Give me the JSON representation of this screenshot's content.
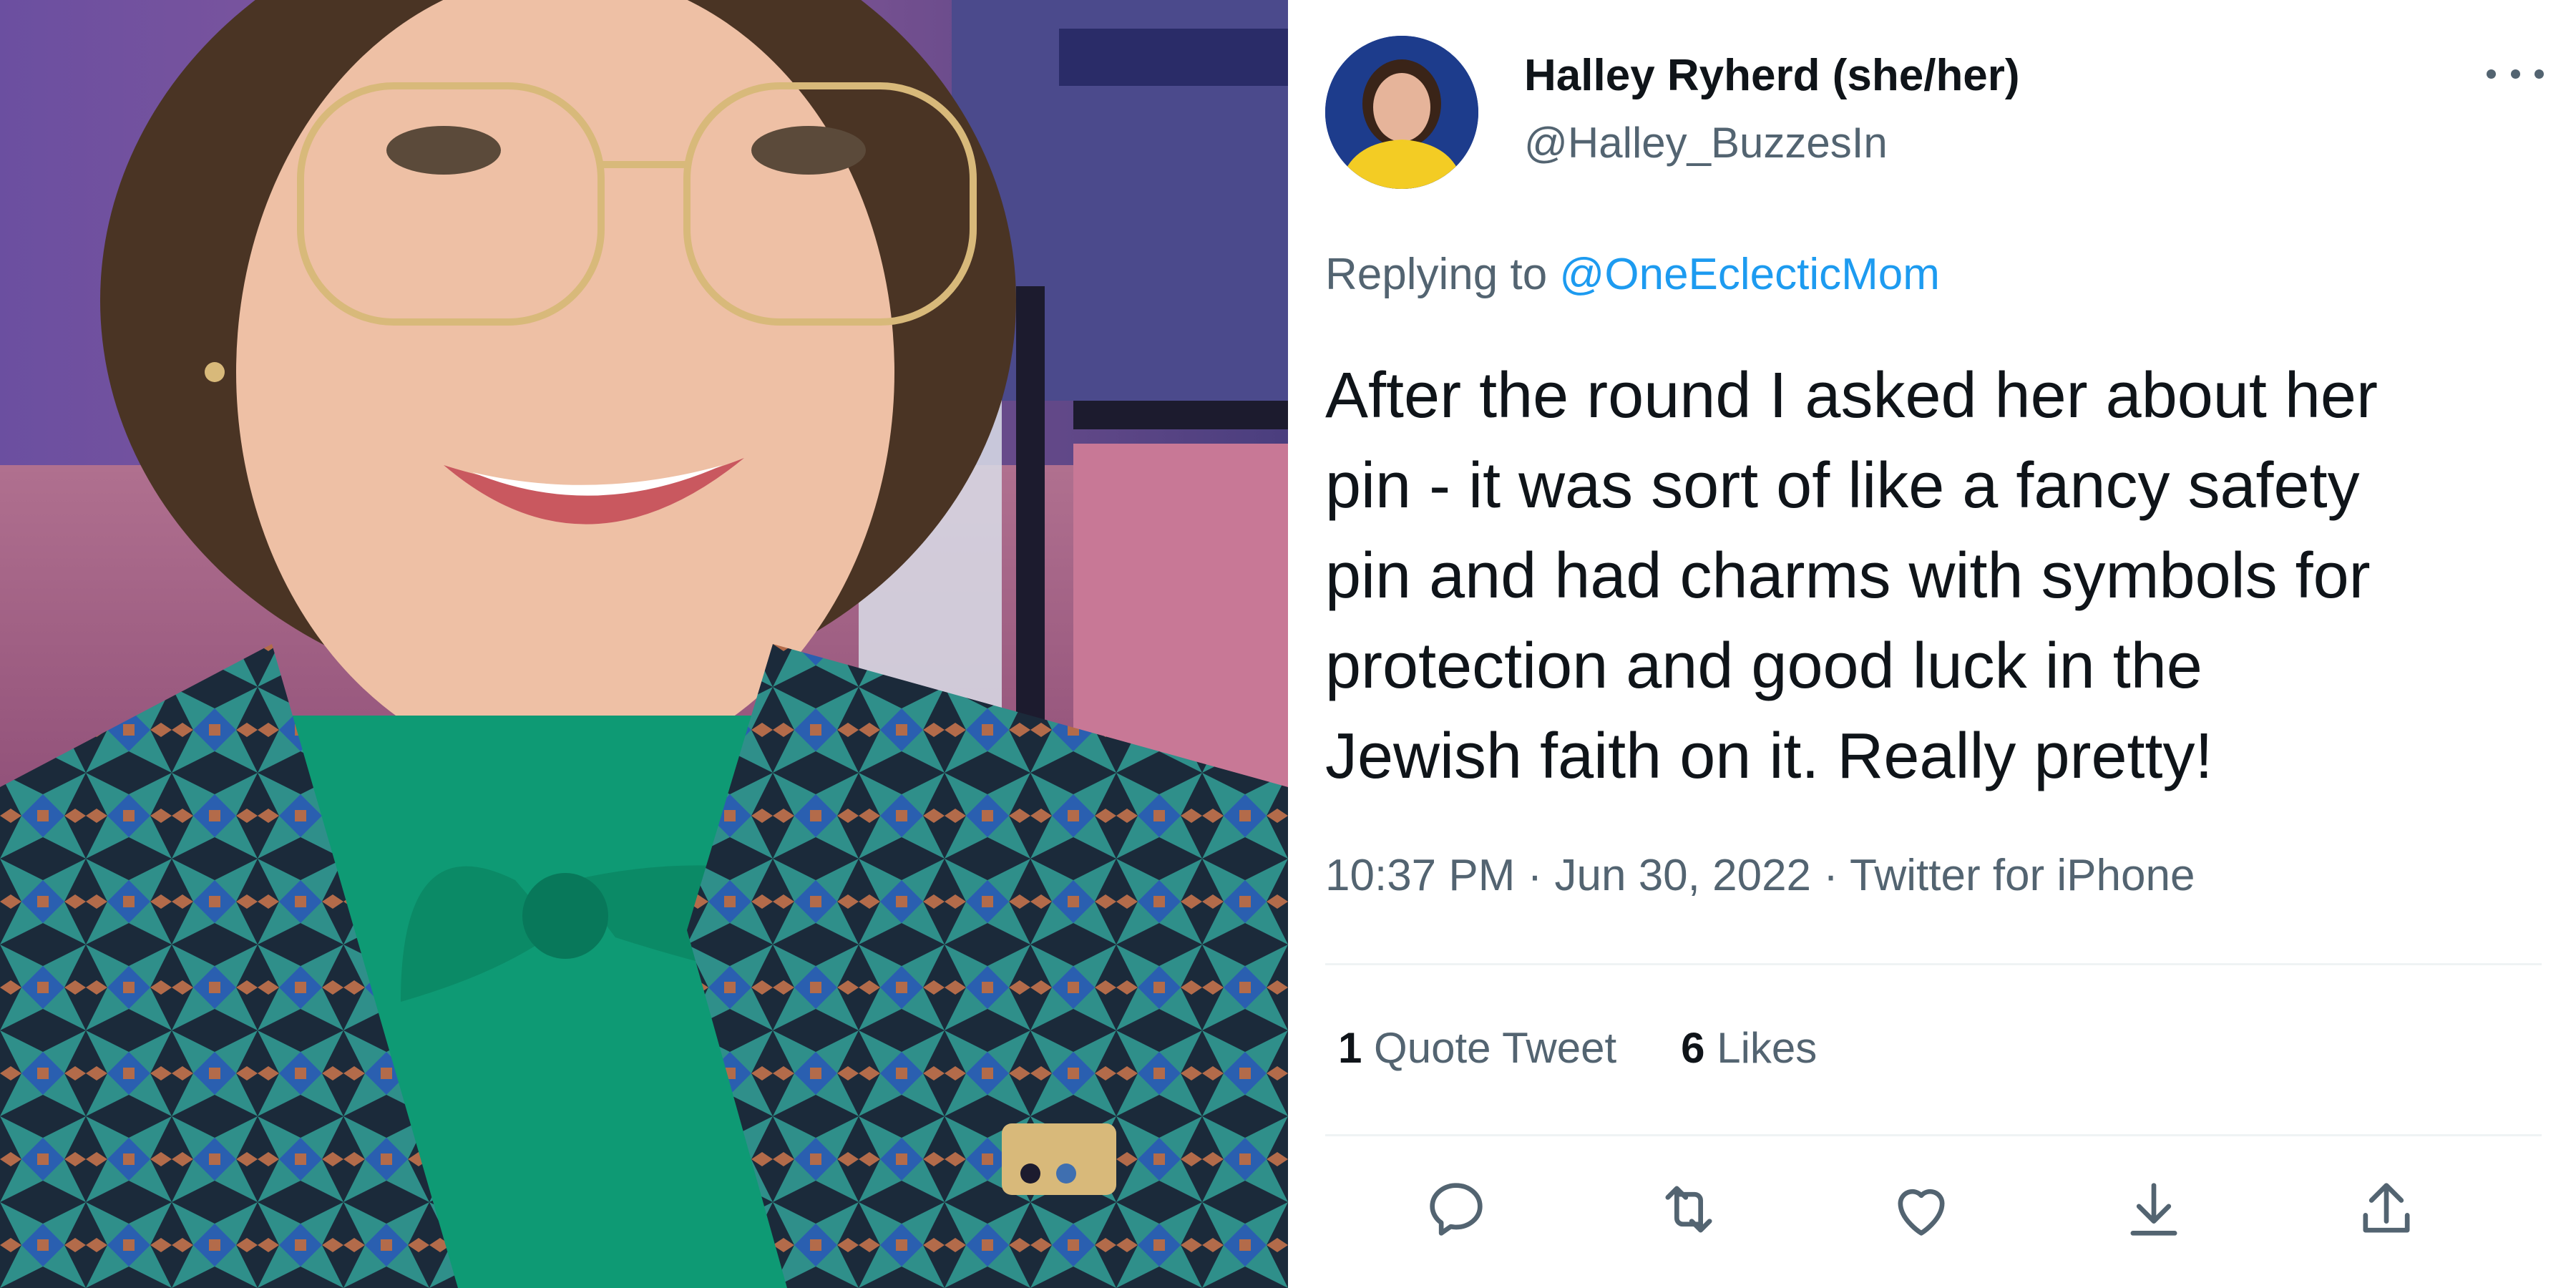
{
  "photo": {
    "alt_subject": "selfie-photo"
  },
  "tweet": {
    "author": {
      "name": "Halley Ryherd (she/her)",
      "handle": "@Halley_BuzzesIn"
    },
    "reply": {
      "prefix": "Replying to ",
      "mention": "@OneEclecticMom"
    },
    "text": "After the round I asked her about her\npin - it was sort of like a fancy safety\npin and had charms with symbols for\nprotection and good luck in the\nJewish faith on it. Really pretty!",
    "time": "10:37 PM",
    "separator": " · ",
    "date": "Jun 30, 2022",
    "source": "Twitter for iPhone",
    "stats": {
      "quote_count": "1",
      "quote_label": " Quote Tweet",
      "like_count": "6",
      "like_label": " Likes"
    },
    "actions": {
      "reply_icon": "reply-icon",
      "retweet_icon": "retweet-icon",
      "like_icon": "heart-icon",
      "bookmark_icon": "bookmark-icon",
      "share_icon": "share-icon"
    }
  },
  "colors": {
    "text_primary": "#0f1419",
    "text_secondary": "#536471",
    "link": "#1d9bf0",
    "divider": "#eff3f4"
  }
}
